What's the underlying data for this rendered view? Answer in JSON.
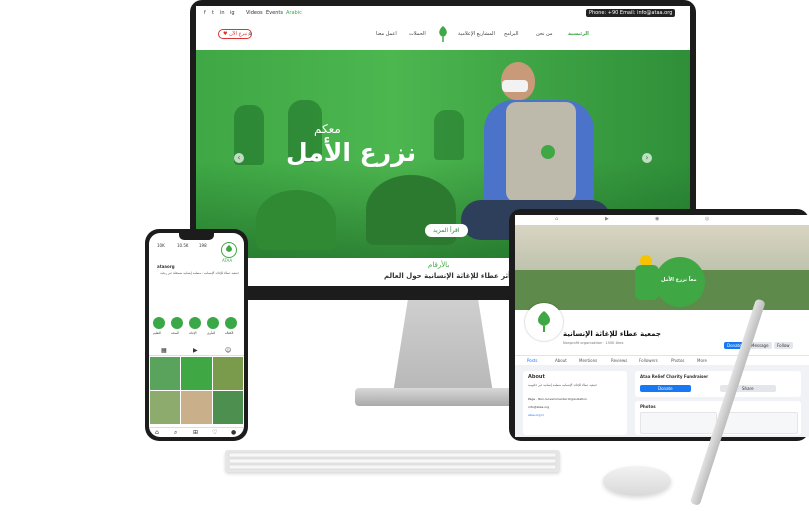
{
  "website": {
    "topbar": {
      "social": [
        "f",
        "t",
        "in",
        "ig"
      ],
      "links": [
        "Videos",
        "Events",
        "Arabic"
      ],
      "contact": "Phone: +90 Email: info@ataa.org"
    },
    "nav": {
      "items": [
        "الرئيسية",
        "من نحن",
        "البرامج",
        "المشاريع الإعلامية",
        "الحملات",
        "اعمل معنا"
      ],
      "donate": "تبرع الآن"
    },
    "hero": {
      "subtitle": "معكم",
      "title": "نزرع الأمل",
      "cta": "اقرأ المزيد",
      "prev": "‹",
      "next": "›"
    },
    "stats": {
      "heading": "بالأرقام",
      "subheading": "أثر عطاء للإغاثة الإنسانية حول العالم"
    }
  },
  "phone": {
    "brand": "ATAA",
    "posts": "10K",
    "followers": "10.5K",
    "following": "198",
    "name": "ataaorg",
    "bio": "جمعية عطاء للإغاثة الإنسانية - منظمة إنسانية مستقلة غير ربحية",
    "highlights": [
      "التعليم",
      "الصحة",
      "الإغاثة",
      "المأوى",
      "الكفالة"
    ]
  },
  "tablet": {
    "page_name": "جمعية عطاء للإغاثة الإنسانية",
    "category": "Nonprofit organization · 150K likes",
    "cover_badge": "معاً نزرع الأمل",
    "buttons": [
      "Donate",
      "Message",
      "Follow"
    ],
    "tabs": [
      "Posts",
      "About",
      "Mentions",
      "Reviews",
      "Followers",
      "Photos",
      "More"
    ],
    "about_title": "About",
    "about_text": "جمعية عطاء للإغاثة الإنسانية منظمة إنسانية غير حكومية",
    "info": [
      "Page · Non-Governmental Organization",
      "info@ataa.org",
      "ataa.org.tr"
    ],
    "fundraiser_title": "Ataa Relief Charity Fundraiser",
    "fundraiser_buttons": [
      "Donate",
      "Share"
    ],
    "photos_label": "Photos"
  },
  "colors": {
    "brand_green": "#3fa845",
    "dark_green": "#2f8f39",
    "device_black": "#1c1c1c",
    "facebook_blue": "#1877f2"
  }
}
